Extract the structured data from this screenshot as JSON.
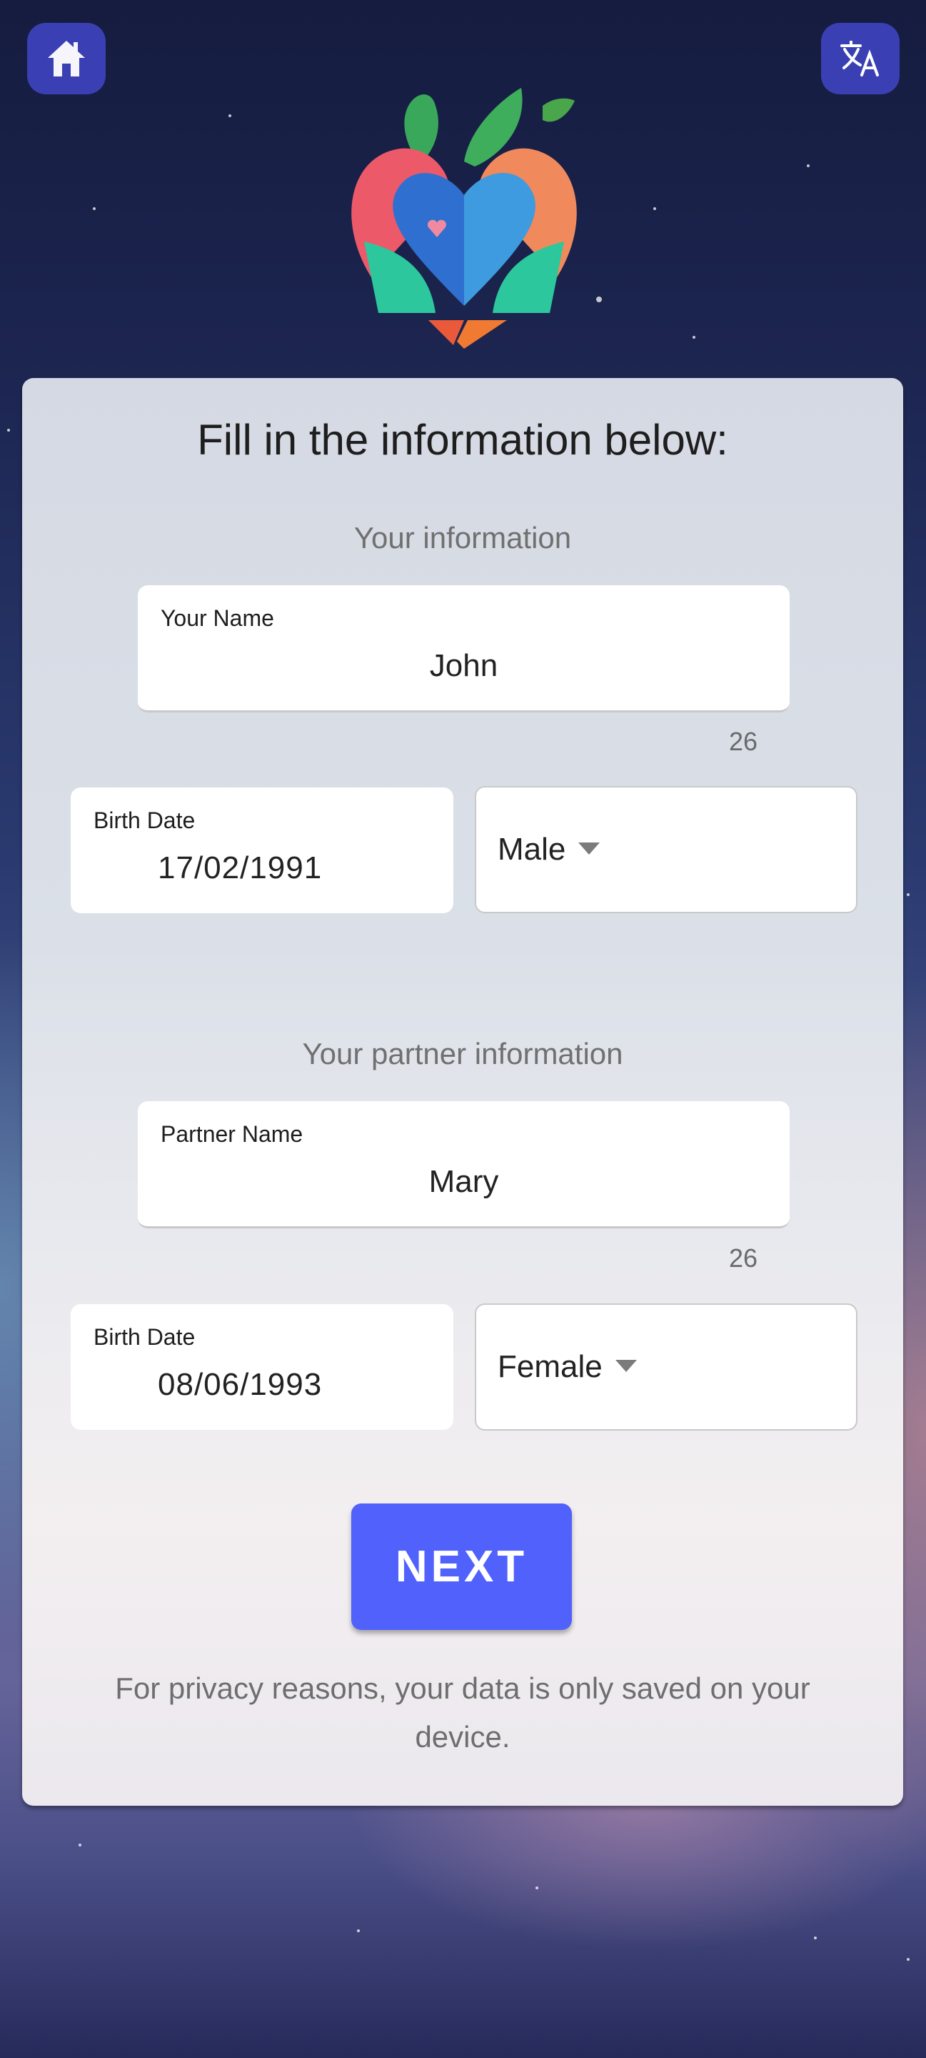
{
  "header": {
    "home_icon": "home-icon",
    "language_icon": "translate-icon",
    "logo": "heart-leaves-logo"
  },
  "form": {
    "title": "Fill in the information below:",
    "you": {
      "section_title": "Your information",
      "name_label": "Your Name",
      "name_value": "John",
      "name_counter": "26",
      "birth_label": "Birth Date",
      "birth_value": "17/02/1991",
      "gender_value": "Male"
    },
    "partner": {
      "section_title": "Your partner information",
      "name_label": "Partner Name",
      "name_value": "Mary",
      "name_counter": "26",
      "birth_label": "Birth Date",
      "birth_value": "08/06/1993",
      "gender_value": "Female"
    },
    "next_label": "NEXT",
    "privacy_note": "For privacy reasons, your data is only saved on your device."
  },
  "colors": {
    "icon_button_bg": "#3a3fb3",
    "next_button_bg": "#5161fc",
    "background_top": "#151c3f"
  }
}
